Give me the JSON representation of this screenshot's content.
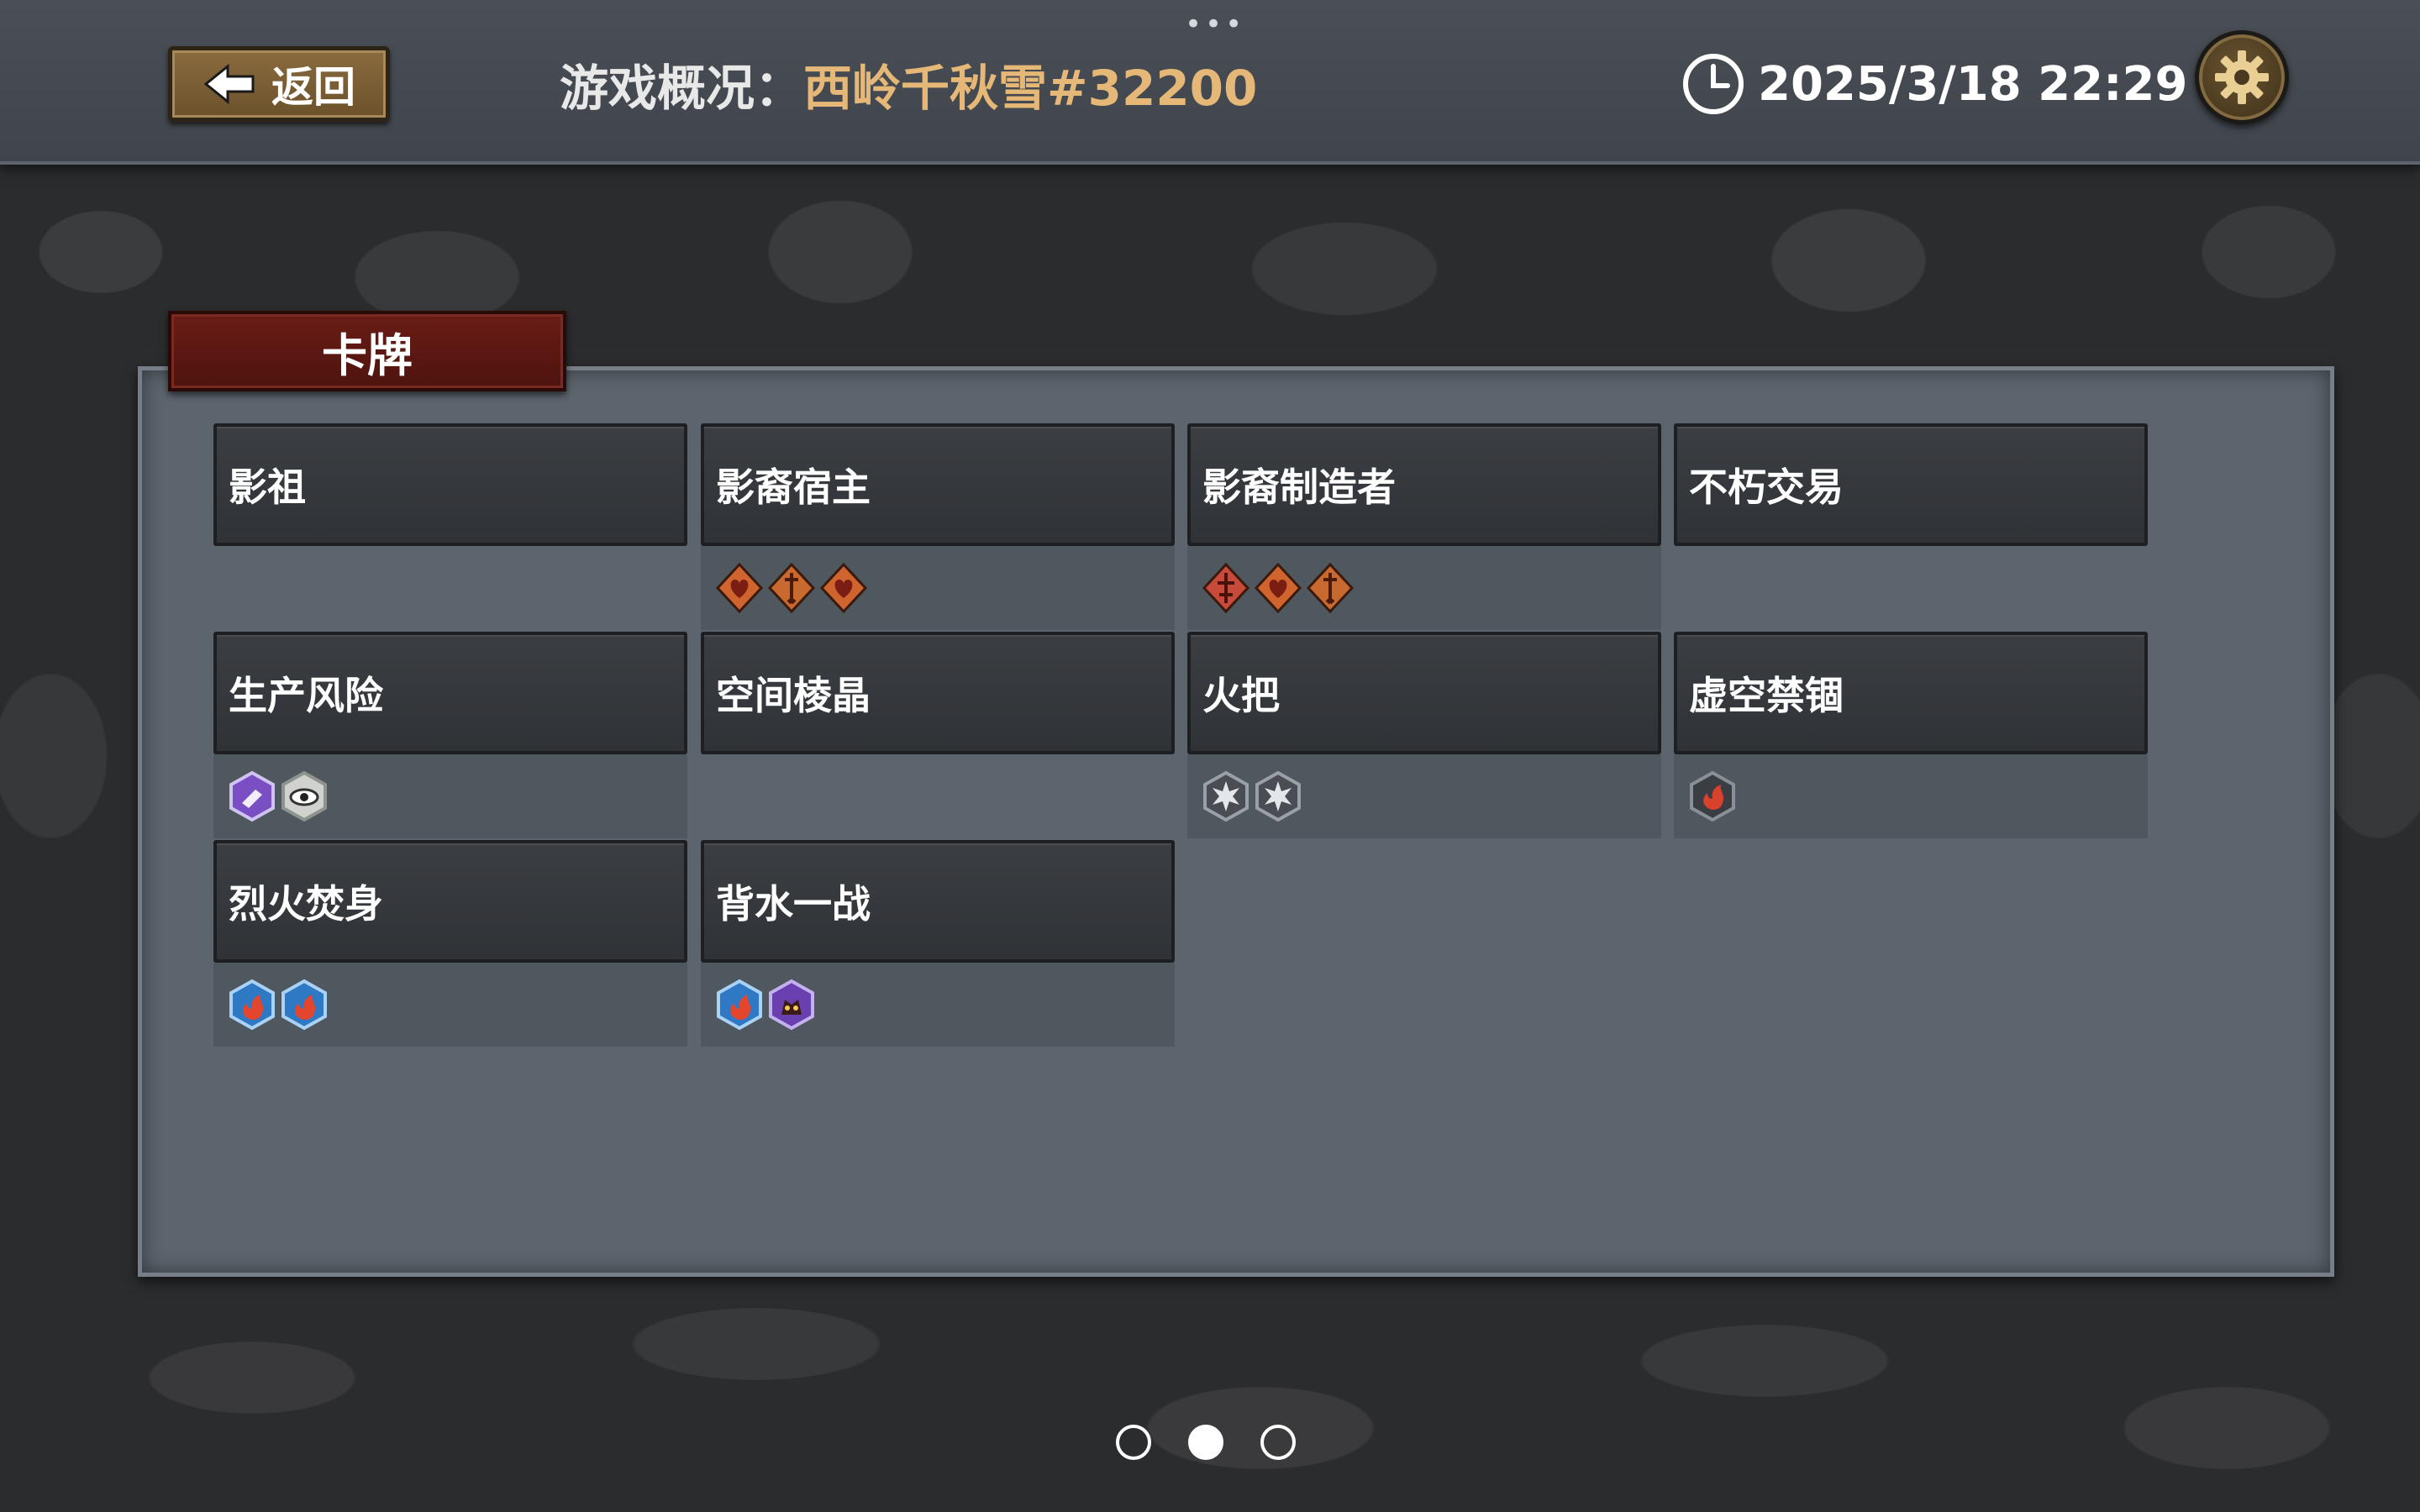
{
  "header": {
    "more_label": "•••",
    "back_label": "返回",
    "title_label": "游戏概况：",
    "title_value": "西岭千秋雪#32200",
    "datetime": "2025/3/18 22:29"
  },
  "section": {
    "title": "卡牌"
  },
  "cards": [
    {
      "name": "影祖",
      "badges": []
    },
    {
      "name": "影裔宿主",
      "badges": [
        "heart-diamond-icon",
        "sword-diamond-icon",
        "heart-diamond-icon"
      ]
    },
    {
      "name": "影裔制造者",
      "badges": [
        "cross-sword-diamond-icon",
        "heart-diamond-icon",
        "sword-diamond-icon"
      ]
    },
    {
      "name": "不朽交易",
      "badges": []
    },
    {
      "name": "生产风险",
      "badges": [
        "purple-hex-icon",
        "eye-hex-icon"
      ]
    },
    {
      "name": "空间棱晶",
      "badges": []
    },
    {
      "name": "火把",
      "badges": [
        "spike-hex-icon",
        "spike-hex-icon"
      ]
    },
    {
      "name": "虚空禁锢",
      "badges": [
        "flame-hex-icon"
      ]
    },
    {
      "name": "烈火焚身",
      "badges": [
        "fire-hex-icon",
        "fire-hex-icon"
      ]
    },
    {
      "name": "背水一战",
      "badges": [
        "fire-hex-icon",
        "purple-beast-hex-icon"
      ]
    }
  ],
  "pager": {
    "count": 3,
    "active_index": 1
  },
  "colors": {
    "accent_gold": "#e6b878",
    "tab_red": "#5a1812",
    "panel": "#5c646d"
  }
}
